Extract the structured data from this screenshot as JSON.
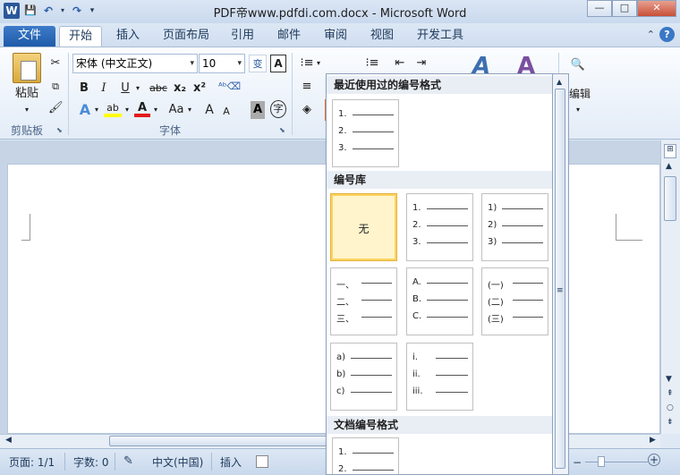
{
  "window": {
    "title": "PDF帝www.pdfdi.com.docx - Microsoft Word",
    "min": "—",
    "max": "□",
    "close": "✕"
  },
  "qat": {
    "app_icon": "W",
    "save": "💾",
    "undo": "↶",
    "redo": "↷",
    "custom": "▾"
  },
  "tabs": [
    "文件",
    "开始",
    "插入",
    "页面布局",
    "引用",
    "邮件",
    "审阅",
    "视图",
    "开发工具"
  ],
  "ribbon": {
    "clipboard": {
      "paste_label": "粘贴",
      "group_label": "剪贴板"
    },
    "font": {
      "font_name": "宋体 (中文正文)",
      "font_size": "10",
      "group_label": "字体",
      "bold": "B",
      "italic": "I",
      "underline": "U",
      "strike": "abc",
      "sub": "x₂",
      "sup": "x²",
      "case": "Aa",
      "grow": "A",
      "shrink": "A",
      "shade": "A",
      "enclose": "字"
    },
    "editing_label": "编辑"
  },
  "dropdown": {
    "recent_header": "最近使用过的编号格式",
    "library_header": "编号库",
    "document_header": "文档编号格式",
    "none_label": "无",
    "recent": [
      [
        "1.",
        "2.",
        "3."
      ]
    ],
    "library": [
      [
        "1.",
        "2.",
        "3."
      ],
      [
        "1)",
        "2)",
        "3)"
      ],
      [
        "一、",
        "二、",
        "三、"
      ],
      [
        "A.",
        "B.",
        "C."
      ],
      [
        "(一)",
        "(二)",
        "(三)"
      ],
      [
        "a)",
        "b)",
        "c)"
      ],
      [
        "i.",
        "ii.",
        "iii."
      ]
    ],
    "document": [
      [
        "1.",
        "2."
      ]
    ]
  },
  "status": {
    "page": "页面: 1/1",
    "words": "字数: 0",
    "lang": "中文(中国)",
    "mode": "插入"
  }
}
